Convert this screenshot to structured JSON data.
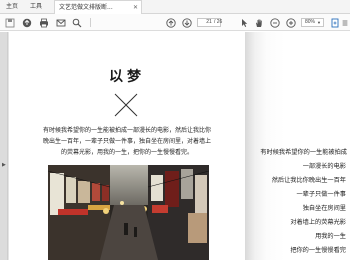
{
  "tabs": {
    "home": "主页",
    "tools": "工具",
    "document": "文艺范做文排版断...",
    "close": "✕"
  },
  "toolbar": {
    "current_page": "21",
    "total_pages": "/ 26",
    "zoom": "80%",
    "zoom_caret": "▼",
    "icons": [
      "save-icon",
      "upload-icon",
      "print-icon",
      "mail-icon",
      "zoom-search-icon",
      "page-up-icon",
      "page-down-icon",
      "pointer-icon",
      "hand-icon",
      "zoom-out-icon",
      "zoom-in-icon",
      "fit-page-icon",
      "more-icon"
    ]
  },
  "page_left": {
    "title": "以梦",
    "lines": [
      "有时候我希望你的一生能被拍成一部漫长的电影，然后让我比你",
      "晚出生一百年，一辈子只做一件事，独自坐在房间里，对着墙上",
      "的荧幕光影，用我的一生，把你的一生慢慢看完。"
    ]
  },
  "page_right": {
    "lines": [
      "有时候我希望你的一生能被拍成",
      "一部漫长的电影",
      "然后让我比你晚出生一百年",
      "一辈子只做一件事",
      "独自坐在房间里",
      "对着墙上的荧幕光影",
      "用我的一生",
      "把你的一生慢慢看完"
    ]
  },
  "colors": {
    "workspace": "#e9e9e9",
    "toolbar": "#fbfbfb",
    "accent_blue": "#2a6ebb"
  }
}
